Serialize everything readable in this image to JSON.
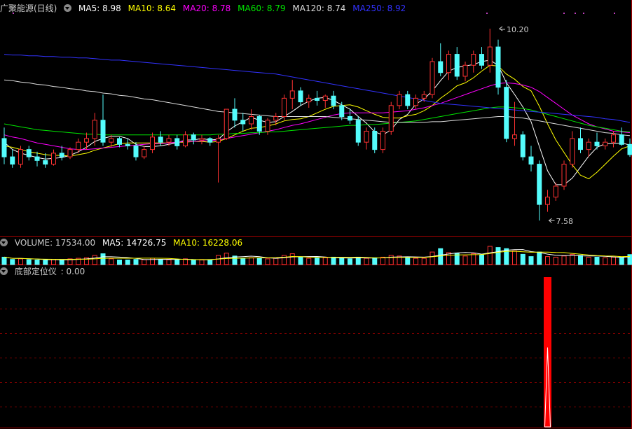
{
  "main_header": {
    "title": "广聚能源(日线)",
    "ma5": "MA5: 8.98",
    "ma10": "MA10: 8.64",
    "ma20": "MA20: 8.78",
    "ma60": "MA60: 8.79",
    "ma120": "MA120: 8.74",
    "ma250": "MA250: 8.92"
  },
  "volume_header": {
    "title": "VOLUME: 17534.00",
    "ma5": "MA5: 14726.75",
    "ma10": "MA10: 16228.06"
  },
  "indicator_header": {
    "title": "底部定位仪",
    "value": ": 0.00"
  },
  "colors": {
    "up": "#ff3232",
    "down": "#54fcfc",
    "ma5": "#ffffff",
    "ma10": "#ffff00",
    "ma20": "#ff00ff",
    "ma60": "#00e600",
    "ma120": "#dddddd",
    "ma250": "#3232ff",
    "divider": "#aa0000",
    "grid": "#7a0000",
    "signal": "#ff0000"
  },
  "chart_data": [
    {
      "type": "candlestick",
      "title": "广聚能源(日线)",
      "ylim": [
        7.4,
        10.4
      ],
      "annotations": [
        {
          "label": "10.20",
          "index": 60,
          "value": 10.2
        },
        {
          "label": "7.58",
          "index": 66,
          "value": 7.58
        }
      ],
      "candles": [
        [
          8.7,
          8.85,
          8.35,
          8.45
        ],
        [
          8.45,
          8.55,
          8.3,
          8.35
        ],
        [
          8.35,
          8.6,
          8.3,
          8.55
        ],
        [
          8.55,
          8.6,
          8.4,
          8.45
        ],
        [
          8.45,
          8.52,
          8.32,
          8.4
        ],
        [
          8.4,
          8.5,
          8.3,
          8.35
        ],
        [
          8.35,
          8.55,
          8.33,
          8.5
        ],
        [
          8.5,
          8.6,
          8.4,
          8.45
        ],
        [
          8.45,
          8.58,
          8.42,
          8.55
        ],
        [
          8.55,
          8.7,
          8.5,
          8.65
        ],
        [
          8.65,
          8.78,
          8.55,
          8.7
        ],
        [
          8.7,
          9.05,
          8.6,
          8.95
        ],
        [
          8.95,
          9.3,
          8.6,
          8.65
        ],
        [
          8.65,
          8.75,
          8.58,
          8.7
        ],
        [
          8.7,
          8.72,
          8.58,
          8.62
        ],
        [
          8.62,
          8.7,
          8.55,
          8.6
        ],
        [
          8.6,
          8.65,
          8.4,
          8.45
        ],
        [
          8.45,
          8.6,
          8.42,
          8.55
        ],
        [
          8.55,
          8.78,
          8.5,
          8.72
        ],
        [
          8.72,
          8.8,
          8.6,
          8.65
        ],
        [
          8.65,
          8.75,
          8.6,
          8.7
        ],
        [
          8.7,
          8.75,
          8.55,
          8.6
        ],
        [
          8.6,
          8.8,
          8.58,
          8.75
        ],
        [
          8.75,
          8.78,
          8.62,
          8.68
        ],
        [
          8.68,
          8.75,
          8.62,
          8.7
        ],
        [
          8.7,
          8.72,
          8.6,
          8.65
        ],
        [
          8.65,
          8.75,
          8.1,
          8.7
        ],
        [
          8.7,
          9.1,
          8.68,
          9.1
        ],
        [
          9.1,
          9.25,
          8.85,
          8.95
        ],
        [
          8.95,
          9.05,
          8.8,
          8.9
        ],
        [
          8.9,
          9.1,
          8.82,
          9.0
        ],
        [
          9.0,
          9.02,
          8.75,
          8.8
        ],
        [
          8.8,
          8.98,
          8.75,
          8.95
        ],
        [
          8.95,
          9.05,
          8.88,
          9.0
        ],
        [
          9.0,
          9.3,
          8.95,
          9.25
        ],
        [
          9.25,
          9.5,
          9.1,
          9.35
        ],
        [
          9.35,
          9.4,
          9.15,
          9.2
        ],
        [
          9.2,
          9.3,
          9.12,
          9.25
        ],
        [
          9.25,
          9.35,
          9.15,
          9.22
        ],
        [
          9.22,
          9.3,
          9.12,
          9.28
        ],
        [
          9.28,
          9.35,
          9.1,
          9.15
        ],
        [
          9.15,
          9.2,
          8.95,
          9.0
        ],
        [
          9.0,
          9.1,
          8.9,
          8.95
        ],
        [
          8.95,
          9.0,
          8.6,
          8.65
        ],
        [
          8.65,
          8.85,
          8.55,
          8.8
        ],
        [
          8.8,
          8.85,
          8.5,
          8.55
        ],
        [
          8.55,
          8.85,
          8.5,
          8.8
        ],
        [
          8.8,
          9.2,
          8.75,
          9.15
        ],
        [
          9.15,
          9.35,
          9.1,
          9.3
        ],
        [
          9.3,
          9.35,
          9.1,
          9.15
        ],
        [
          9.15,
          9.3,
          9.1,
          9.25
        ],
        [
          9.25,
          9.35,
          9.2,
          9.3
        ],
        [
          9.3,
          9.8,
          9.25,
          9.75
        ],
        [
          9.75,
          10.0,
          9.55,
          9.6
        ],
        [
          9.6,
          9.9,
          9.5,
          9.85
        ],
        [
          9.85,
          9.95,
          9.5,
          9.55
        ],
        [
          9.55,
          9.75,
          9.48,
          9.7
        ],
        [
          9.7,
          9.9,
          9.6,
          9.85
        ],
        [
          9.85,
          9.95,
          9.65,
          9.7
        ],
        [
          9.7,
          10.2,
          9.6,
          9.95
        ],
        [
          9.95,
          10.05,
          9.3,
          9.4
        ],
        [
          9.4,
          9.5,
          8.65,
          8.7
        ],
        [
          8.7,
          9.2,
          8.6,
          8.75
        ],
        [
          8.75,
          8.8,
          8.4,
          8.45
        ],
        [
          8.45,
          8.6,
          8.25,
          8.35
        ],
        [
          8.35,
          8.4,
          7.58,
          7.8
        ],
        [
          7.8,
          8.0,
          7.7,
          7.9
        ],
        [
          7.9,
          8.1,
          7.85,
          8.05
        ],
        [
          8.05,
          8.4,
          8.0,
          8.35
        ],
        [
          8.35,
          8.8,
          8.3,
          8.7
        ],
        [
          8.7,
          8.85,
          8.5,
          8.55
        ],
        [
          8.55,
          8.7,
          8.45,
          8.65
        ],
        [
          8.65,
          8.78,
          8.55,
          8.6
        ],
        [
          8.6,
          8.7,
          8.55,
          8.65
        ],
        [
          8.65,
          8.8,
          8.58,
          8.75
        ],
        [
          8.75,
          8.85,
          8.6,
          8.62
        ],
        [
          8.62,
          8.7,
          8.45,
          8.48
        ]
      ],
      "ma_series": [
        {
          "name": "MA5",
          "values": [
            8.65,
            8.55,
            8.5,
            8.47,
            8.44,
            8.42,
            8.43,
            8.44,
            8.47,
            8.52,
            8.58,
            8.66,
            8.7,
            8.73,
            8.73,
            8.7,
            8.62,
            8.59,
            8.59,
            8.6,
            8.62,
            8.64,
            8.68,
            8.68,
            8.7,
            8.68,
            8.69,
            8.79,
            8.87,
            8.93,
            8.99,
            8.95,
            8.92,
            8.93,
            9.0,
            9.07,
            9.15,
            9.21,
            9.25,
            9.26,
            9.22,
            9.16,
            9.1,
            9.0,
            8.91,
            8.79,
            8.75,
            8.82,
            8.96,
            9.03,
            9.17,
            9.24,
            9.35,
            9.49,
            9.62,
            9.67,
            9.69,
            9.71,
            9.75,
            9.77,
            9.7,
            9.46,
            9.3,
            9.13,
            8.93,
            8.59,
            8.26,
            8.07,
            8.07,
            8.16,
            8.31,
            8.46,
            8.58,
            8.63,
            8.63,
            8.64,
            8.61
          ]
        },
        {
          "name": "MA10",
          "values": [
            8.6,
            8.58,
            8.55,
            8.52,
            8.5,
            8.48,
            8.47,
            8.47,
            8.46,
            8.48,
            8.5,
            8.54,
            8.57,
            8.6,
            8.63,
            8.64,
            8.64,
            8.64,
            8.64,
            8.64,
            8.64,
            8.65,
            8.65,
            8.66,
            8.66,
            8.65,
            8.66,
            8.7,
            8.75,
            8.8,
            8.84,
            8.85,
            8.87,
            8.9,
            8.94,
            8.96,
            8.97,
            9.0,
            9.05,
            9.1,
            9.14,
            9.15,
            9.16,
            9.13,
            9.08,
            9.03,
            8.99,
            8.98,
            8.98,
            9.01,
            9.03,
            9.08,
            9.15,
            9.25,
            9.33,
            9.42,
            9.46,
            9.53,
            9.62,
            9.7,
            9.69,
            9.58,
            9.51,
            9.41,
            9.35,
            9.14,
            8.9,
            8.68,
            8.51,
            8.34,
            8.2,
            8.15,
            8.24,
            8.35,
            8.46,
            8.56,
            8.6
          ]
        },
        {
          "name": "MA20",
          "values": [
            8.75,
            8.72,
            8.7,
            8.67,
            8.64,
            8.62,
            8.6,
            8.58,
            8.56,
            8.55,
            8.55,
            8.56,
            8.57,
            8.58,
            8.59,
            8.6,
            8.61,
            8.62,
            8.63,
            8.63,
            8.64,
            8.65,
            8.66,
            8.66,
            8.67,
            8.67,
            8.68,
            8.7,
            8.72,
            8.74,
            8.76,
            8.78,
            8.8,
            8.82,
            8.85,
            8.88,
            8.9,
            8.93,
            8.96,
            8.99,
            9.02,
            9.04,
            9.05,
            9.05,
            9.05,
            9.05,
            9.05,
            9.06,
            9.07,
            9.08,
            9.1,
            9.12,
            9.15,
            9.18,
            9.22,
            9.26,
            9.3,
            9.34,
            9.38,
            9.42,
            9.45,
            9.46,
            9.45,
            9.43,
            9.4,
            9.34,
            9.26,
            9.18,
            9.1,
            9.02,
            8.96,
            8.9,
            8.86,
            8.83,
            8.8,
            8.79,
            8.78
          ]
        },
        {
          "name": "MA60",
          "values": [
            8.9,
            8.88,
            8.86,
            8.84,
            8.82,
            8.81,
            8.8,
            8.79,
            8.78,
            8.77,
            8.76,
            8.76,
            8.75,
            8.75,
            8.75,
            8.75,
            8.75,
            8.75,
            8.75,
            8.75,
            8.75,
            8.75,
            8.75,
            8.75,
            8.75,
            8.75,
            8.76,
            8.76,
            8.77,
            8.77,
            8.78,
            8.78,
            8.79,
            8.79,
            8.8,
            8.81,
            8.82,
            8.83,
            8.84,
            8.85,
            8.86,
            8.87,
            8.88,
            8.88,
            8.89,
            8.89,
            8.9,
            8.91,
            8.92,
            8.93,
            8.94,
            8.96,
            8.98,
            9.0,
            9.02,
            9.04,
            9.06,
            9.08,
            9.1,
            9.12,
            9.13,
            9.13,
            9.12,
            9.11,
            9.09,
            9.06,
            9.03,
            9.0,
            8.97,
            8.94,
            8.91,
            8.88,
            8.86,
            8.84,
            8.82,
            8.8,
            8.79
          ]
        },
        {
          "name": "MA120",
          "values": [
            9.5,
            9.49,
            9.47,
            9.46,
            9.44,
            9.43,
            9.41,
            9.4,
            9.38,
            9.37,
            9.35,
            9.34,
            9.32,
            9.31,
            9.29,
            9.28,
            9.26,
            9.24,
            9.23,
            9.21,
            9.19,
            9.17,
            9.15,
            9.13,
            9.11,
            9.09,
            9.07,
            9.06,
            9.05,
            9.04,
            9.03,
            9.02,
            9.01,
            9.0,
            9.0,
            9.0,
            9.0,
            9.0,
            9.0,
            9.0,
            8.99,
            8.98,
            8.97,
            8.96,
            8.95,
            8.94,
            8.93,
            8.92,
            8.92,
            8.92,
            8.92,
            8.92,
            8.93,
            8.93,
            8.94,
            8.95,
            8.96,
            8.97,
            8.98,
            8.99,
            9.0,
            9.0,
            8.99,
            8.98,
            8.96,
            8.94,
            8.92,
            8.9,
            8.88,
            8.86,
            8.84,
            8.82,
            8.8,
            8.78,
            8.77,
            8.75,
            8.74
          ]
        },
        {
          "name": "MA250",
          "values": [
            9.85,
            9.84,
            9.84,
            9.83,
            9.83,
            9.82,
            9.82,
            9.81,
            9.81,
            9.8,
            9.8,
            9.79,
            9.78,
            9.77,
            9.77,
            9.76,
            9.75,
            9.74,
            9.73,
            9.72,
            9.71,
            9.7,
            9.69,
            9.68,
            9.67,
            9.66,
            9.65,
            9.64,
            9.63,
            9.62,
            9.61,
            9.6,
            9.59,
            9.58,
            9.56,
            9.54,
            9.52,
            9.5,
            9.48,
            9.46,
            9.44,
            9.42,
            9.4,
            9.38,
            9.36,
            9.34,
            9.32,
            9.3,
            9.28,
            9.26,
            9.24,
            9.22,
            9.2,
            9.18,
            9.17,
            9.16,
            9.15,
            9.14,
            9.13,
            9.12,
            9.11,
            9.1,
            9.09,
            9.08,
            9.07,
            9.06,
            9.05,
            9.04,
            9.03,
            9.02,
            9.01,
            9.0,
            8.99,
            8.97,
            8.96,
            8.94,
            8.92
          ]
        }
      ]
    },
    {
      "type": "bar",
      "title": "VOLUME: 17534.00",
      "series": [
        {
          "name": "VOLUME",
          "values": [
            13000,
            9000,
            10000,
            8500,
            8000,
            7500,
            9000,
            8000,
            10000,
            11000,
            12000,
            16000,
            19000,
            10000,
            8000,
            8000,
            9000,
            8500,
            11000,
            9000,
            8500,
            8000,
            10000,
            8000,
            8000,
            7500,
            16000,
            20000,
            15000,
            11000,
            12000,
            11000,
            10000,
            11000,
            16000,
            19000,
            13000,
            11000,
            11500,
            12000,
            13000,
            11000,
            10000,
            13000,
            11000,
            12000,
            13000,
            16000,
            15000,
            12000,
            11000,
            11000,
            22000,
            28000,
            21000,
            20000,
            15000,
            19000,
            17000,
            32000,
            30000,
            28000,
            24000,
            18000,
            14000,
            22000,
            14000,
            13000,
            15000,
            18000,
            16000,
            13000,
            13000,
            12000,
            13000,
            12500,
            17534
          ]
        },
        {
          "name": "MA5",
          "values": []
        },
        {
          "name": "MA10",
          "values": []
        }
      ]
    },
    {
      "type": "bar",
      "title": "底部定位仪",
      "signal_index": 66,
      "series": [
        {
          "name": "底部定位仪",
          "values": [
            0,
            0,
            0,
            0,
            0,
            0,
            0,
            0,
            0,
            0,
            0,
            0,
            0,
            0,
            0,
            0,
            0,
            0,
            0,
            0,
            0,
            0,
            0,
            0,
            0,
            0,
            0,
            0,
            0,
            0,
            0,
            0,
            0,
            0,
            0,
            0,
            0,
            0,
            0,
            0,
            0,
            0,
            0,
            0,
            0,
            0,
            0,
            0,
            0,
            0,
            0,
            0,
            0,
            0,
            0,
            0,
            0,
            0,
            0,
            0,
            0,
            0,
            0,
            0,
            0,
            0,
            100,
            0,
            0,
            0,
            0,
            0,
            0,
            0,
            0,
            0,
            0
          ]
        }
      ]
    }
  ]
}
